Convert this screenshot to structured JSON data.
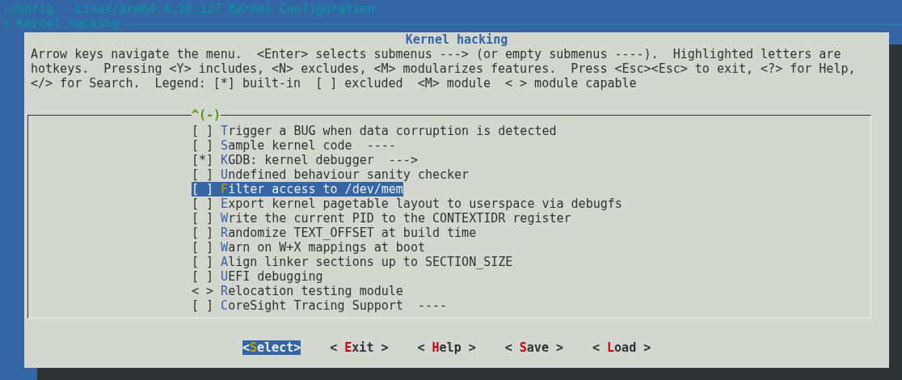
{
  "window": {
    "title": ".config - Linux/arm64 4.19.127 Kernel Configuration",
    "breadcrumb": "> Kernel hacking"
  },
  "dialog": {
    "title": "Kernel hacking",
    "help_lines": [
      "Arrow keys navigate the menu.  <Enter> selects submenus ---> (or empty submenus ----).  Highlighted letters are",
      "hotkeys.  Pressing <Y> includes, <N> excludes, <M> modularizes features.  Press <Esc><Esc> to exit, <?> for Help,",
      "</> for Search.  Legend: [*] built-in  [ ] excluded  <M> module  < > module capable"
    ]
  },
  "menu": {
    "scroll_indicator": "^(-)",
    "items": [
      {
        "marker": "[ ]",
        "label": "Trigger a BUG when data corruption is detected",
        "selected": false
      },
      {
        "marker": "[ ]",
        "label": "Sample kernel code  ----",
        "selected": false
      },
      {
        "marker": "[*]",
        "label": "KGDB: kernel debugger  --->",
        "selected": false
      },
      {
        "marker": "[ ]",
        "label": "Undefined behaviour sanity checker",
        "selected": false
      },
      {
        "marker": "[ ]",
        "label": "Filter access to /dev/mem",
        "selected": true
      },
      {
        "marker": "[ ]",
        "label": "Export kernel pagetable layout to userspace via debugfs",
        "selected": false
      },
      {
        "marker": "[ ]",
        "label": "Write the current PID to the CONTEXTIDR register",
        "selected": false
      },
      {
        "marker": "[ ]",
        "label": "Randomize TEXT_OFFSET at build time",
        "selected": false
      },
      {
        "marker": "[ ]",
        "label": "Warn on W+X mappings at boot",
        "selected": false
      },
      {
        "marker": "[ ]",
        "label": "Align linker sections up to SECTION_SIZE",
        "selected": false
      },
      {
        "marker": "[ ]",
        "label": "UEFI debugging",
        "selected": false
      },
      {
        "marker": "< >",
        "label": "Relocation testing module",
        "selected": false
      },
      {
        "marker": "[ ]",
        "label": "CoreSight Tracing Support  ----",
        "selected": false
      }
    ]
  },
  "buttons": [
    {
      "text": "<Select>",
      "selected": true
    },
    {
      "text": "< Exit >",
      "selected": false
    },
    {
      "text": "< Help >",
      "selected": false
    },
    {
      "text": "< Save >",
      "selected": false
    },
    {
      "text": "< Load >",
      "selected": false
    }
  ]
}
